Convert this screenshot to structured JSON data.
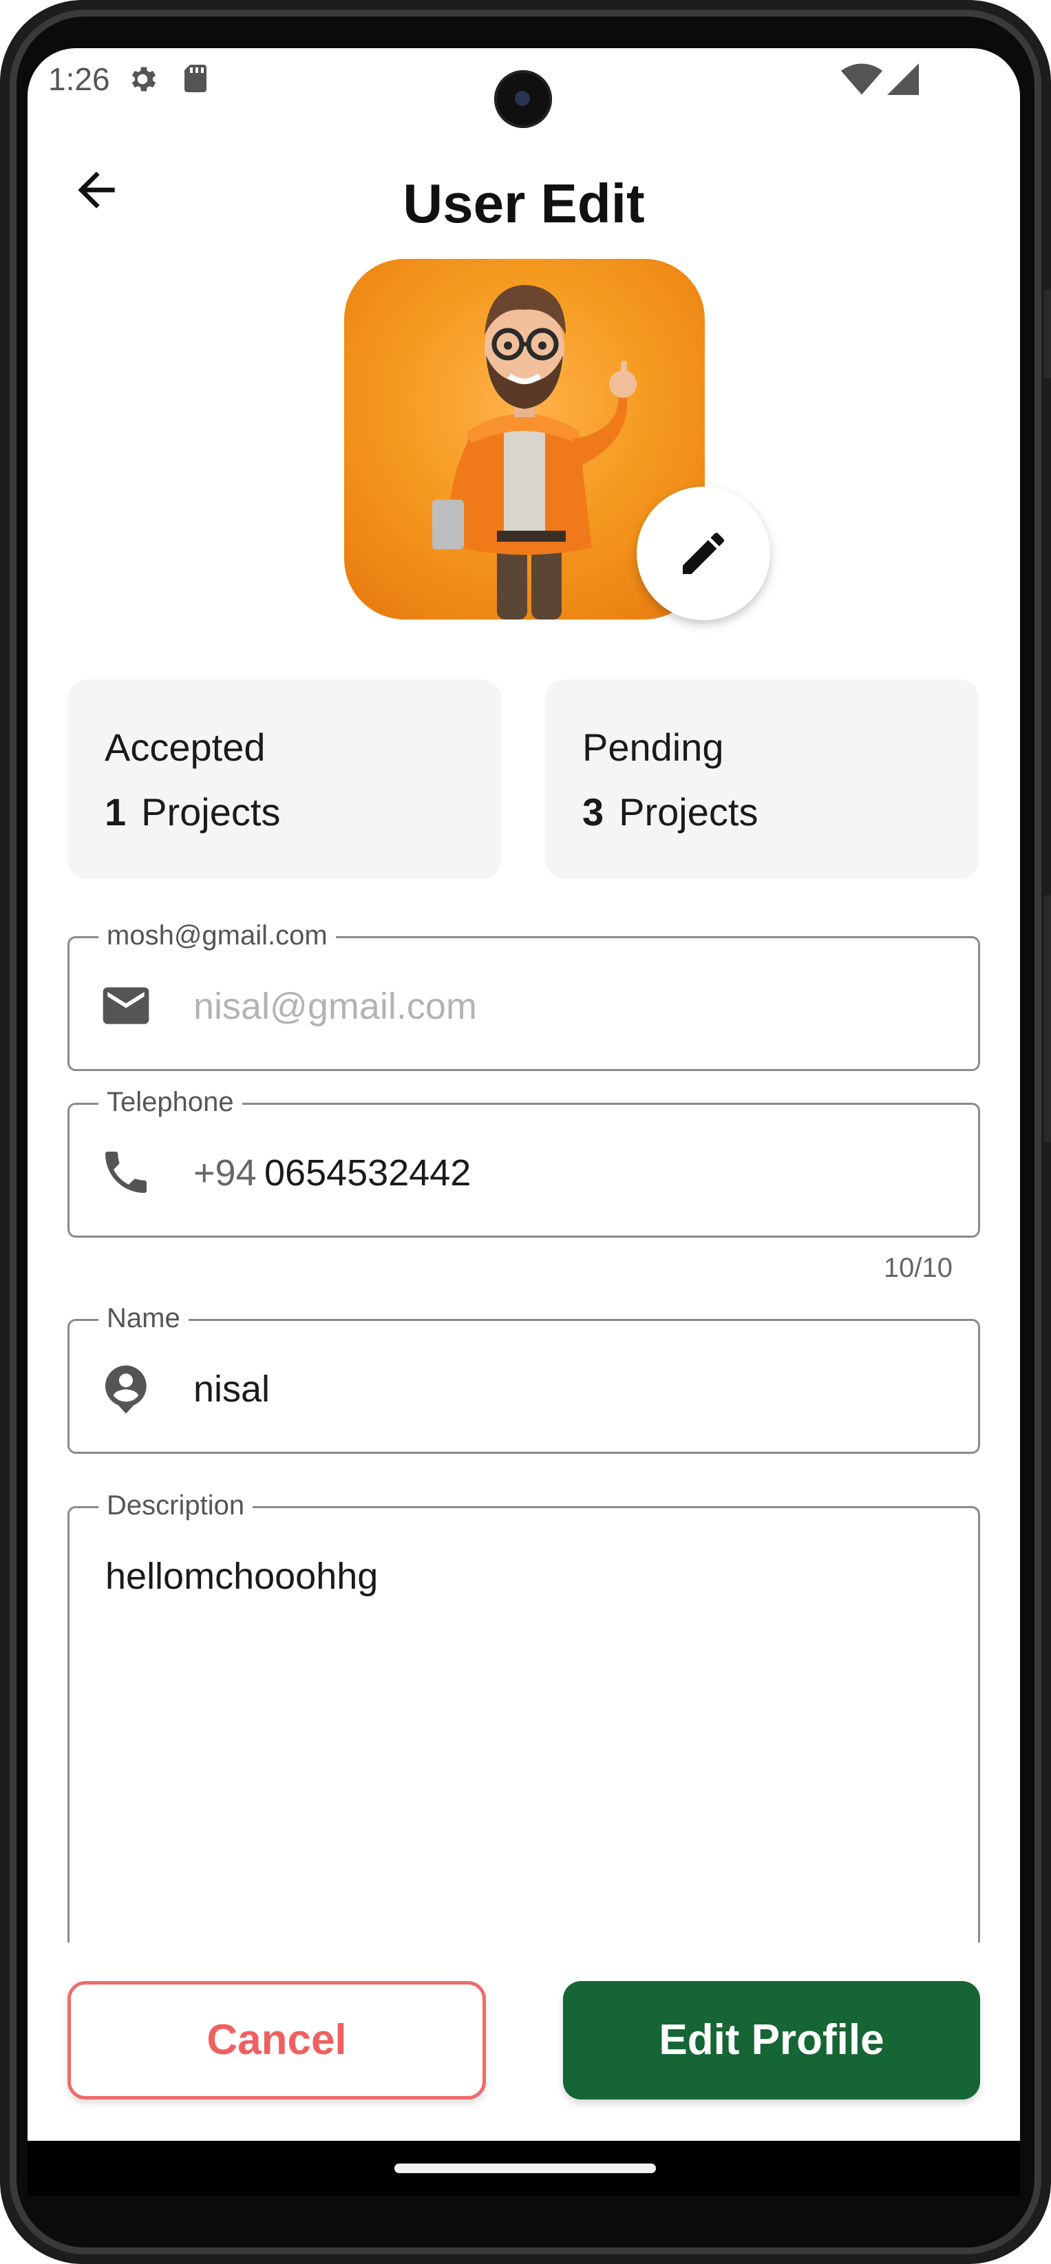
{
  "status_bar": {
    "time": "1:26",
    "icons": [
      "settings-icon",
      "sd-card-icon",
      "wifi-icon",
      "signal-icon"
    ]
  },
  "app_bar": {
    "title": "User Edit",
    "back_icon": "arrow-back-icon"
  },
  "avatar": {
    "image": "3d-cartoon-man-avatar",
    "edit_icon": "pencil-icon"
  },
  "stats": {
    "accepted": {
      "title": "Accepted",
      "count": "1",
      "unit": "Projects"
    },
    "pending": {
      "title": "Pending",
      "count": "3",
      "unit": "Projects"
    }
  },
  "form": {
    "email": {
      "label": "mosh@gmail.com",
      "placeholder": "nisal@gmail.com",
      "value": "",
      "icon": "mail-icon"
    },
    "telephone": {
      "label": "Telephone",
      "prefix": "+94",
      "value": "0654532442",
      "counter": "10/10",
      "icon": "phone-icon"
    },
    "name": {
      "label": "Name",
      "value": "nisal",
      "icon": "account-circle-icon"
    },
    "description": {
      "label": "Description",
      "value": "hellomchooohhg"
    }
  },
  "actions": {
    "cancel_label": "Cancel",
    "edit_label": "Edit Profile"
  },
  "colors": {
    "primary": "#166534",
    "cancel": "#ef6060",
    "avatar_bg": "#f59a1f"
  }
}
